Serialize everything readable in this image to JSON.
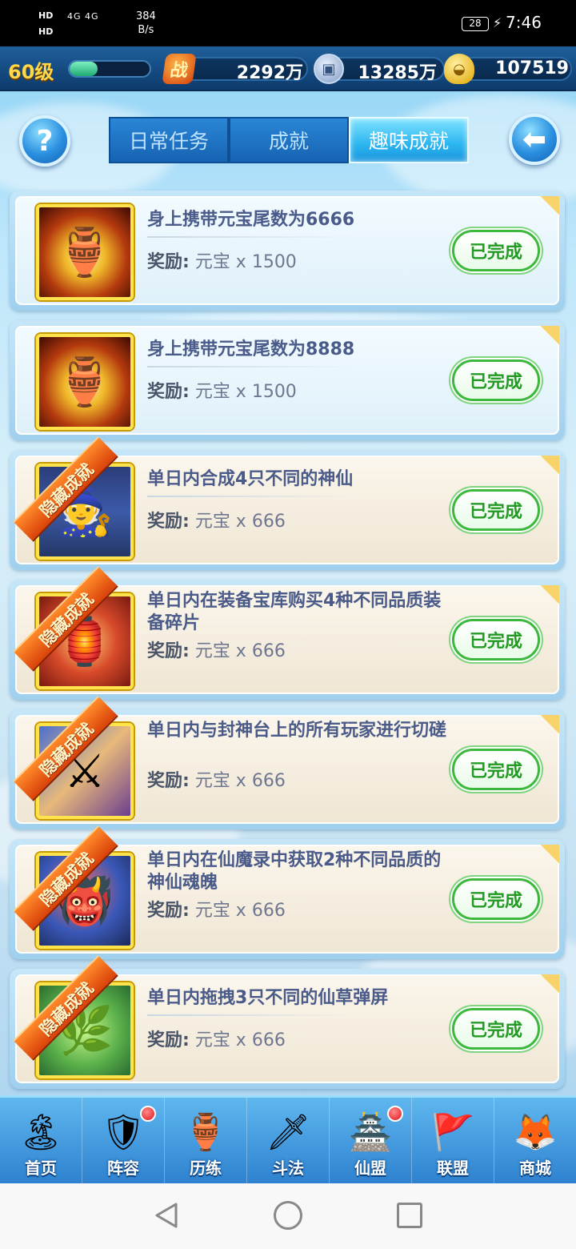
{
  "status_bar": {
    "hd1": "HD",
    "hd2": "HD",
    "signal": "4G 4G",
    "speed_value": "384",
    "speed_unit": "B/s",
    "battery": "28",
    "time": "7:46"
  },
  "topbar": {
    "level": "60级",
    "xp_fraction": 0.35,
    "combat_icon": "战",
    "combat_power": "2292万",
    "copper": "13285万",
    "gold_ingot": "107519"
  },
  "tabs": [
    {
      "label": "日常任务",
      "active": false
    },
    {
      "label": "成就",
      "active": false
    },
    {
      "label": "趣味成就",
      "active": true
    }
  ],
  "reward_label": "奖励:",
  "done_label": "已完成",
  "hidden_ribbon": "隐藏成就",
  "tasks": [
    {
      "title": "身上携带元宝尾数为6666",
      "reward": "元宝 x 1500",
      "hidden": false,
      "icon": "gold-treasure-bowl-icon"
    },
    {
      "title": "身上携带元宝尾数为8888",
      "reward": "元宝 x 1500",
      "hidden": false,
      "icon": "gold-treasure-bowl-icon"
    },
    {
      "title": "单日内合成4只不同的神仙",
      "reward": "元宝 x 666",
      "hidden": true,
      "icon": "immortal-character-icon"
    },
    {
      "title": "单日内在装备宝库购买4种不同品质装备碎片",
      "reward": "元宝 x 666",
      "hidden": true,
      "icon": "equipment-vault-icon"
    },
    {
      "title": "单日内与封神台上的所有玩家进行切磋",
      "reward": "元宝 x 666",
      "hidden": true,
      "icon": "duel-heroes-icon"
    },
    {
      "title": "单日内在仙魔录中获取2种不同品质的神仙魂魄",
      "reward": "元宝 x 666",
      "hidden": true,
      "icon": "demon-record-icon"
    },
    {
      "title": "单日内拖拽3只不同的仙草弹屏",
      "reward": "元宝 x 666",
      "hidden": true,
      "icon": "herb-sprite-icon"
    }
  ],
  "bottom_nav": [
    {
      "label": "首页",
      "icon": "home-island-icon",
      "badge": false
    },
    {
      "label": "阵容",
      "icon": "lineup-icon",
      "badge": true
    },
    {
      "label": "历练",
      "icon": "training-gourd-icon",
      "badge": false
    },
    {
      "label": "斗法",
      "icon": "battle-sword-icon",
      "badge": false
    },
    {
      "label": "仙盟",
      "icon": "immortal-alliance-palace-icon",
      "badge": true
    },
    {
      "label": "联盟",
      "icon": "alliance-banner-icon",
      "badge": false
    },
    {
      "label": "商城",
      "icon": "shop-fox-girl-icon",
      "badge": false
    }
  ],
  "colors": {
    "accent_blue": "#2a86d6",
    "done_green": "#239a23",
    "ribbon_orange": "#d9420a",
    "level_gold": "#ffd84a"
  }
}
